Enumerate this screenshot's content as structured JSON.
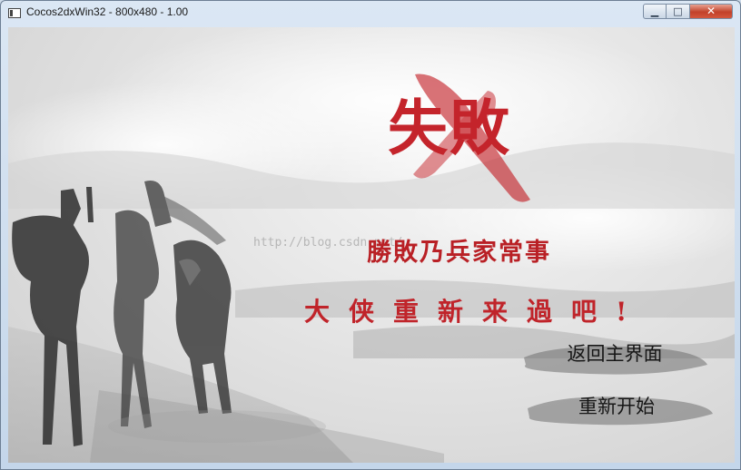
{
  "window": {
    "title": "Cocos2dxWin32 - 800x480 - 1.00",
    "minimize_icon": "minimize-icon",
    "maximize_icon": "maximize-icon",
    "close_icon": "close-icon"
  },
  "game": {
    "fail_title": "失敗",
    "subtitle": "勝敗乃兵家常事",
    "slogan": "大侠重新来過吧!",
    "watermark": "http://blog.csdn.net/",
    "buttons": {
      "home": "返回主界面",
      "restart": "重新开始"
    }
  },
  "colors": {
    "accent_red": "#c4242b",
    "close_button": "#c2412a"
  }
}
